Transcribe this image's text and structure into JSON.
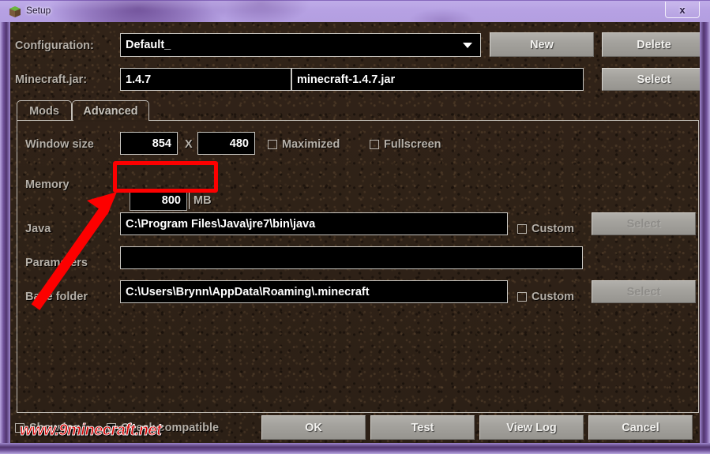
{
  "window": {
    "title": "Setup",
    "icon": "grass-block-icon",
    "close_label": "x",
    "titlebar_color": "#b3a0e0",
    "client_bg_color": "#2e2117"
  },
  "toolbar": {
    "configuration_label": "Configuration:",
    "configuration_value": "Default_",
    "new_label": "New",
    "delete_label": "Delete",
    "minecraft_jar_label": "Minecraft.jar:",
    "minecraft_jar_version": "1.4.7",
    "minecraft_jar_file": "minecraft-1.4.7.jar",
    "select_label": "Select"
  },
  "tabs": [
    {
      "label": "Mods",
      "active": false
    },
    {
      "label": "Advanced",
      "active": true
    }
  ],
  "advanced": {
    "window_size_label": "Window size",
    "window_width": "854",
    "window_size_separator": "X",
    "window_height": "480",
    "maximized_label": "Maximized",
    "maximized_checked": false,
    "fullscreen_label": "Fullscreen",
    "fullscreen_checked": false,
    "memory_label": "Memory",
    "memory_value": "800",
    "memory_unit": "MB",
    "java_label": "Java",
    "java_value": "C:\\Program Files\\Java\\jre7\\bin\\java",
    "java_custom_label": "Custom",
    "java_custom_checked": false,
    "java_select_label": "Select",
    "parameters_label": "Parameters",
    "parameters_value": "",
    "base_folder_label": "Base folder",
    "base_folder_value": "C:\\Users\\Brynn\\AppData\\Roaming\\.minecraft",
    "base_folder_custom_label": "Custom",
    "base_folder_custom_checked": false,
    "base_folder_select_label": "Select"
  },
  "footer": {
    "show_log_label": "Show log",
    "show_log_checked": false,
    "check_compatible_label": "Check compatible",
    "check_compatible_checked": true,
    "ok_label": "OK",
    "test_label": "Test",
    "view_log_label": "View Log",
    "cancel_label": "Cancel"
  },
  "annotation": {
    "highlight_color": "#fd0000",
    "arrow_color": "#fd0000",
    "target": "memory-field"
  },
  "watermark": {
    "text": "www.9minecraft.net",
    "color": "#d40000"
  }
}
